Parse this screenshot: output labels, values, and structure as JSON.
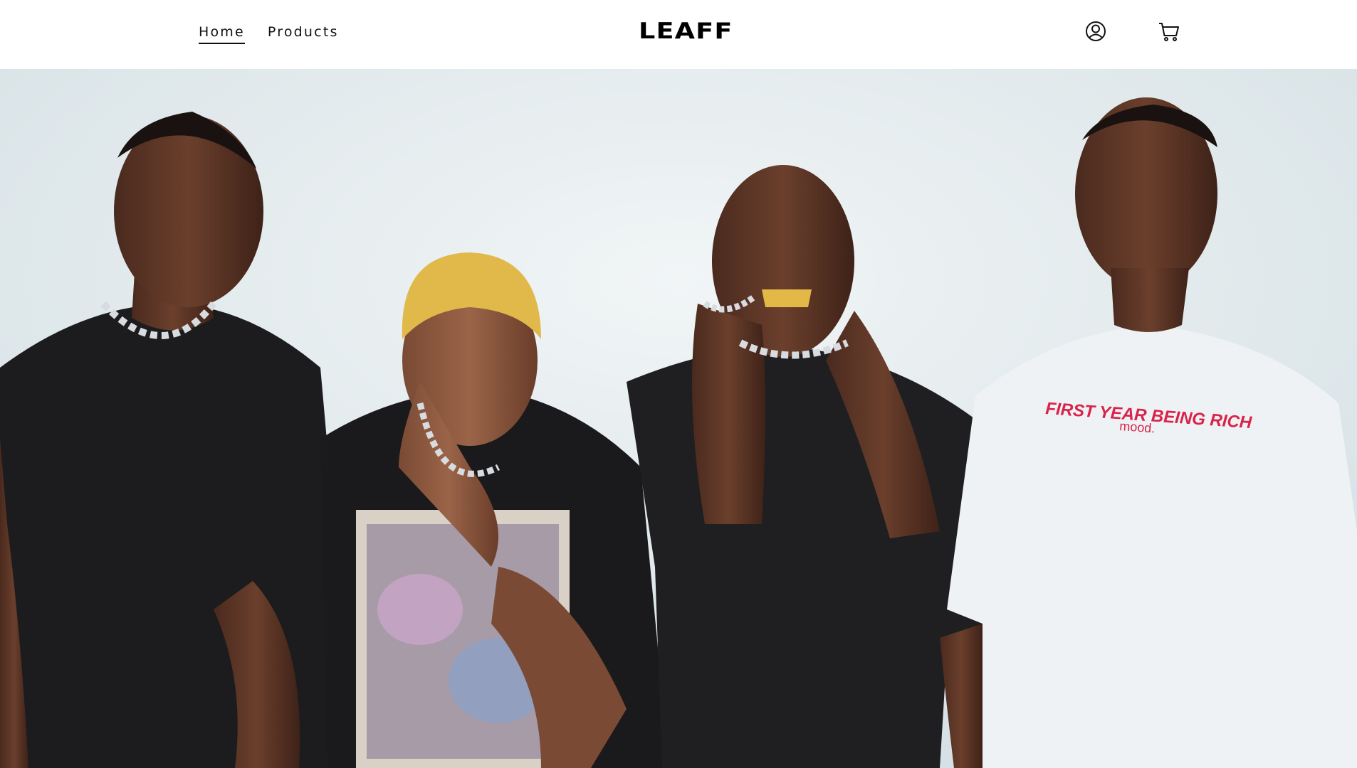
{
  "nav": {
    "items": [
      {
        "label": "Home",
        "active": true
      },
      {
        "label": "Products",
        "active": false
      }
    ]
  },
  "brand": {
    "logo_text": "LEAFF"
  },
  "header_icons": {
    "account": "account-icon",
    "cart": "cart-icon"
  },
  "hero": {
    "shirt_print_line1": "FIRST YEAR BEING RICH",
    "shirt_print_line2": "mood.",
    "colors": {
      "backdrop": "#e4ecef",
      "shirt_black": "#1c1c1e",
      "shirt_white": "#eef2f4",
      "print_red": "#d9234b",
      "chain_silver": "#c9ccd1",
      "hair_blonde": "#e0b94a",
      "skin_dark": "#5a3324"
    }
  }
}
